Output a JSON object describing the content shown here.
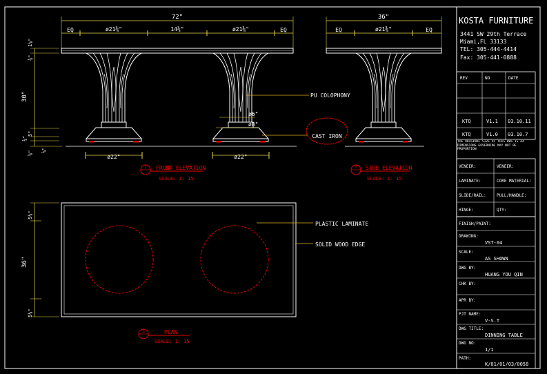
{
  "front_elevation": {
    "overall_width": "72\"",
    "seg_eq_left": "EQ",
    "seg_leg_left": "ø21⅜\"",
    "seg_mid": "14⅜\"",
    "seg_leg_right": "ø21⅜\"",
    "seg_eq_right": "EQ",
    "dim_top_thk": "1⅛\"",
    "dim_apron": "¾\"",
    "dim_height": "30\"",
    "dim_base_a": "5\"",
    "dim_base_b": "¾\"",
    "dim_base_c": "⅝\"",
    "dim_base_d": "⅓\"",
    "dim_col_6": "ø6\"",
    "dim_col_8": "ø8\"",
    "base_left": "ø22\"",
    "base_right": "ø22\"",
    "label_column": "PU COLOPHONY",
    "label_cast_iron": "CAST IRON",
    "title_num": "1",
    "title": "FRONT ELEVATION",
    "scale": "SCALE: 1: 15"
  },
  "side_elevation": {
    "overall_width": "36\"",
    "seg_eq_left": "EQ",
    "seg_leg": "ø21⅜\"",
    "seg_eq_right": "EQ",
    "title_num": "2",
    "title": "SIDE ELEVATION",
    "scale": "SCALE: 1: 15"
  },
  "plan": {
    "dim_top": "5⅛\"",
    "dim_depth": "36\"",
    "dim_bottom": "5⅛\"",
    "label_laminate": "PLASTIC LAMINATE",
    "label_edge": "SOLID WOOD EDGE",
    "title_num": "3",
    "title": "PLAN",
    "scale": "SCALE: 1: 15"
  },
  "title_block": {
    "company": "KOSTA FURNITURE",
    "address1": "3441 SW 29th Terrace",
    "address2": "Miami,FL   33133",
    "tel": "TEL:  305-444-4414",
    "fax": "Fax:  305-441-0888",
    "rev_header": [
      "REV",
      "NO",
      "DATE"
    ],
    "rev_rows": [
      [
        "KTQ",
        "V1.1",
        "03.10.11"
      ],
      [
        "KTQ",
        "V1.0",
        "03.10.7"
      ]
    ],
    "notice": "THE ORIGINAL SIZE OF THIS DWG IS A4 DIMENSIONS GOVERNING MAY NOT BE PROPORTION",
    "veneer1_label": "VENEER:",
    "veneer2_label": "VENEER:",
    "laminate_label": "LAMINATE:",
    "core_label": "CORE MATERIAL:",
    "slide_label": "SLIDE/RAIL:",
    "pull_label": "PULL/HANDLE:",
    "hinge_label": "HINGE:",
    "qty_label": "QTY:",
    "finish_label": "FINISH/PAINT:",
    "drawing_no_label": "DRAWING:",
    "drawing_no": "VST-04",
    "scale_label": "SCALE:",
    "scale_value": "AS SHOWN",
    "dwg_by_label": "DWG BY:",
    "dwg_by": "HUANG YOU QIN",
    "chk_by_label": "CHK BY:",
    "apr_by_label": "APR BY:",
    "pjt_name_label": "PJT NAME:",
    "pjt_name": "V-S.T",
    "dwg_title_label": "DWG TITLE:",
    "dwg_title": "DINNING TABLE",
    "dwg_no_label": "DWG NO:",
    "dwg_no": "1/1",
    "path_label": "PATH:",
    "path": "K/01/01/03/0058"
  },
  "colors": {
    "background": "#000000",
    "linework": "#ffffff",
    "dimension": "#e8d84a",
    "annotation": "#ff2020",
    "leader": "#e8b020"
  }
}
